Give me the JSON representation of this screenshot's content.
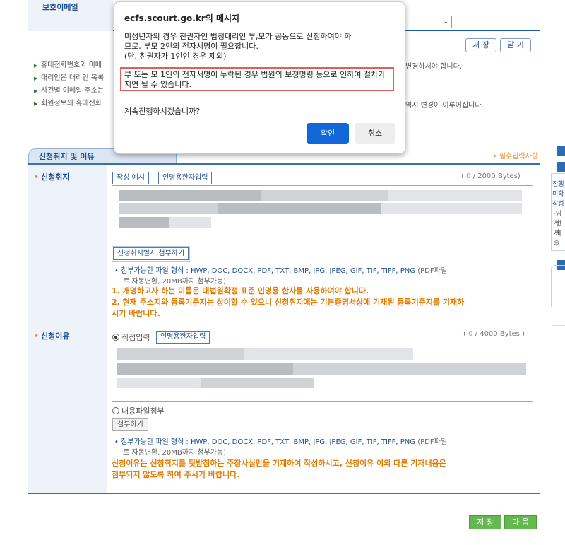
{
  "top_form": {
    "label": "보호이메일",
    "save_label": "저 장",
    "close_label": "닫 기"
  },
  "info": {
    "items": [
      "휴대전화번호와 이메",
      "대리인은 대리인 목록",
      "사건별 이메일 주소는",
      "회원정보의 휴대전화"
    ],
    "right_1": "변경하셔야 합니다.",
    "right_3": "역시 변경이 이루어집니다."
  },
  "section": {
    "title": "신청취지 및 이유",
    "required_note": "• 필수입력사항"
  },
  "purpose": {
    "label": "신청취지",
    "example_button": "작성 예시",
    "hanja_button": "인명용한자입력",
    "bytes_count": "0",
    "bytes_total": "/ 2000 Bytes)",
    "bytes_open": "(",
    "attach_button": "신청취지별지 첨부하기",
    "file_note": "• 첨부가능한 파일 형식 : HWP, DOC, DOCX, PDF, TXT, BMP, JPG, JPEG, GIF, TIF, TIFF, PNG",
    "file_note_gray": "(PDF파일",
    "file_note_2": "로 자동변환, 20MB까지 첨부가능)",
    "warn_1": "1. 개명하고자 하는 이름은 대법원확정 표준 인명용 한자를 사용하여야 합니다.",
    "warn_2a": "2. 현재 주소지와 등록기준지는 상이할 수 있으니 신청취지에는 기본증명서상에 기재된 등록기준지를 기재하",
    "warn_2b": "시기 바랍니다."
  },
  "reason": {
    "label": "신청이유",
    "direct_label": "직접입력",
    "hanja_button": "인명용한자입력",
    "bytes_count": "0",
    "bytes_total": "/ 4000 Bytes )",
    "bytes_open": "(",
    "file_radio_label": "내용파일첨부",
    "attach_button": "첨부하기",
    "file_note": "• 첨부가능한 파일 형식 : HWP, DOC, DOCX, PDF, TXT, BMP, JPG, JPEG, GIF, TIF, TIFF, PNG",
    "file_note_gray": "(PDF파일",
    "file_note_2": "로 자동변환, 20MB까지 첨부가능)",
    "warn_a": "신청이유는 신청취지를 뒷받침하는 주장사실만을 기재하여 작성하시고, 신청이유 이외 다른 기재내용은",
    "warn_b": "첨부되지 않도록 하여 주시기 바랍니다."
  },
  "bottom": {
    "save_label": "저 장",
    "next_label": "다 음"
  },
  "sidebar": {
    "lines": [
      "진행",
      "미확",
      "작성",
      "·임시",
      "·전자",
      "·제출"
    ]
  },
  "dialog": {
    "title": "ecfs.scourt.go.kr의 메시지",
    "line_1": "미성년자의 경우 친권자인 법정대리인 부,모가 공동으로 신청하여야 하",
    "line_2": "므로, 부모 2인의 전자서명이 필요합니다.",
    "line_3": "(단, 친권자가 1인인 경우 제외)",
    "highlight": "부 또는 모 1인의 전자서명이 누락된 경우 법원의 보정명령 등으로 인하여 절차가 지연 될 수 있습니다.",
    "question": "계속진행하시겠습니까?",
    "ok_label": "확인",
    "cancel_label": "취소"
  }
}
